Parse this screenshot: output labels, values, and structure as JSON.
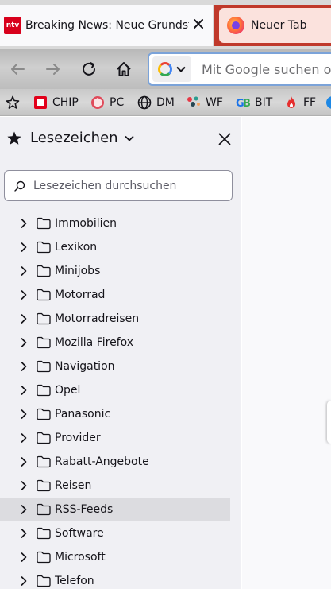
{
  "tabs": [
    {
      "title": "Breaking News: Neue Grundsteuer",
      "icon": "ntv-favicon",
      "icon_text": "ntv",
      "active": true
    },
    {
      "title": "Neuer Tab",
      "icon": "firefox-icon",
      "active": false
    }
  ],
  "urlbar": {
    "placeholder": "Mit Google suchen oder Adresse eingeben",
    "engine_icon": "google-icon"
  },
  "bookmarks_toolbar": [
    {
      "label": "",
      "icon": "manage-bookmarks-icon"
    },
    {
      "label": "CHIP",
      "icon": "chip-icon"
    },
    {
      "label": "PC",
      "icon": "pc-icon"
    },
    {
      "label": "DM",
      "icon": "globe-icon"
    },
    {
      "label": "WF",
      "icon": "wf-icon"
    },
    {
      "label": "BIT",
      "icon": "bit-icon"
    },
    {
      "label": "FF",
      "icon": "flame-icon"
    }
  ],
  "sidebar": {
    "title": "Lesezeichen",
    "search_placeholder": "Lesezeichen durchsuchen",
    "folders": [
      "Immobilien",
      "Lexikon",
      "Minijobs",
      "Motorrad",
      "Motorradreisen",
      "Mozilla Firefox",
      "Navigation",
      "Opel",
      "Panasonic",
      "Provider",
      "Rabatt-Angebote",
      "Reisen",
      "RSS-Feeds",
      "Software",
      "Microsoft",
      "Telefon"
    ],
    "hovered_folder": "RSS-Feeds"
  },
  "colors": {
    "accent": "#c0392b",
    "hover_row": "#dcdce0",
    "sidebar_bg": "#f0f0f4",
    "focus_border": "#7ba3d9"
  }
}
